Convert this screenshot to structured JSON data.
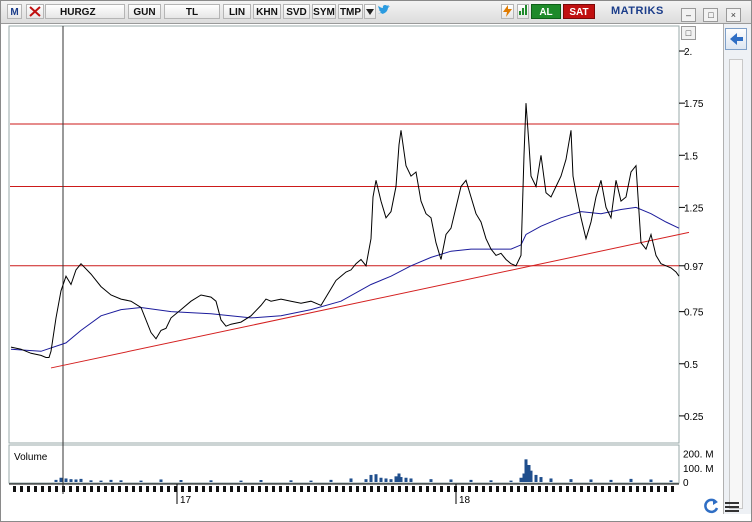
{
  "toolbar": {
    "logo": "M",
    "symbol": "HURGZ",
    "period": "GUN",
    "currency": "TL",
    "scale_lin": "LIN",
    "btn_khn": "KHN",
    "btn_svd": "SVD",
    "btn_sym": "SYM",
    "btn_tmp": "TMP",
    "buy": "AL",
    "sell": "SAT",
    "brand": "MATRIKS"
  },
  "colors": {
    "price": "#000000",
    "moving_average": "#1c1c9c",
    "support_lines": "#cc1a1a",
    "volume": "#1f4e8c",
    "buy": "#1e8a2a",
    "sell": "#c01010"
  },
  "icons": [
    "close-x-icon",
    "twitter-bird-icon",
    "lightning-icon",
    "refresh-icon",
    "menu-icon",
    "arrow-left-icon"
  ],
  "chart_data": {
    "type": "line",
    "title": "",
    "xlabel": "",
    "ylabel": "",
    "ylim": [
      0.12,
      2.12
    ],
    "y_ticks": [
      "2.",
      "1.75",
      "1.5",
      "1.25",
      "0.97",
      "0.75",
      "0.5",
      "0.25"
    ],
    "y_tick_values": [
      2.0,
      1.75,
      1.5,
      1.25,
      0.97,
      0.75,
      0.5,
      0.25
    ],
    "x_tick_labels": [
      "17",
      "18"
    ],
    "grid": false,
    "scale": "linear",
    "series": [],
    "price": {
      "x": [
        0,
        10,
        20,
        30,
        35,
        38,
        40,
        45,
        50,
        55,
        60,
        65,
        70,
        80,
        90,
        100,
        110,
        120,
        130,
        140,
        145,
        150,
        155,
        160,
        170,
        180,
        190,
        200,
        205,
        210,
        215,
        220,
        230,
        240,
        250,
        255,
        260,
        270,
        280,
        290,
        300,
        310,
        320,
        325,
        330,
        335,
        340,
        345,
        350,
        355,
        360,
        362,
        365,
        368,
        370,
        375,
        380,
        385,
        388,
        390,
        395,
        400,
        405,
        410,
        415,
        420,
        425,
        430,
        435,
        440,
        445,
        450,
        455,
        460,
        465,
        470,
        475,
        480,
        485,
        490,
        495,
        500,
        505,
        510,
        513,
        515,
        518,
        520,
        525,
        530,
        535,
        540,
        545,
        550,
        555,
        560,
        562,
        565,
        570,
        575,
        580,
        585,
        590,
        595,
        600,
        605,
        610,
        615,
        620,
        625,
        630,
        635,
        640,
        645,
        650,
        655,
        660,
        665,
        668
      ],
      "y": [
        0.58,
        0.57,
        0.55,
        0.54,
        0.53,
        0.53,
        0.56,
        0.72,
        0.85,
        0.92,
        0.88,
        0.95,
        0.98,
        0.93,
        0.87,
        0.83,
        0.81,
        0.8,
        0.77,
        0.65,
        0.62,
        0.66,
        0.67,
        0.72,
        0.76,
        0.8,
        0.83,
        0.82,
        0.8,
        0.71,
        0.68,
        0.69,
        0.7,
        0.73,
        0.78,
        0.81,
        0.8,
        0.81,
        0.8,
        0.79,
        0.8,
        0.78,
        0.86,
        0.9,
        0.92,
        0.94,
        0.95,
        0.98,
        1.0,
        0.97,
        1.1,
        1.3,
        1.38,
        1.32,
        1.28,
        1.2,
        1.23,
        1.35,
        1.55,
        1.62,
        1.45,
        1.4,
        1.42,
        1.28,
        1.22,
        1.2,
        1.08,
        1.0,
        1.12,
        1.15,
        1.25,
        1.35,
        1.38,
        1.3,
        1.22,
        1.18,
        1.1,
        1.05,
        1.02,
        1.03,
        1.0,
        0.98,
        0.97,
        1.02,
        1.5,
        1.75,
        1.55,
        1.4,
        1.35,
        1.5,
        1.32,
        1.3,
        1.35,
        1.4,
        1.48,
        1.62,
        1.4,
        1.32,
        1.2,
        1.1,
        1.18,
        1.3,
        1.38,
        1.25,
        1.2,
        1.38,
        1.28,
        1.3,
        1.42,
        1.45,
        1.08,
        1.05,
        1.12,
        1.02,
        0.98,
        0.97,
        0.96,
        0.94,
        0.92
      ]
    },
    "moving_average": {
      "x": [
        0,
        30,
        55,
        70,
        90,
        110,
        130,
        160,
        200,
        240,
        270,
        300,
        330,
        360,
        380,
        400,
        420,
        440,
        460,
        480,
        500,
        510,
        515,
        530,
        550,
        570,
        590,
        610,
        625,
        640,
        655,
        668
      ],
      "y": [
        0.57,
        0.56,
        0.6,
        0.66,
        0.73,
        0.76,
        0.77,
        0.75,
        0.74,
        0.72,
        0.73,
        0.76,
        0.8,
        0.88,
        0.92,
        0.97,
        1.01,
        1.04,
        1.05,
        1.05,
        1.05,
        1.07,
        1.12,
        1.16,
        1.2,
        1.23,
        1.22,
        1.24,
        1.25,
        1.22,
        1.18,
        1.15
      ]
    },
    "horizontal_lines": [
      1.65,
      1.35,
      0.97
    ],
    "trendline": {
      "x": [
        40,
        678
      ],
      "y": [
        0.48,
        1.13
      ]
    },
    "x_tick_positions": [
      176,
      455
    ],
    "volume": {
      "label": "Volume",
      "y_ticks": [
        "200. M",
        "100. M",
        "0"
      ],
      "y_tick_values": [
        200,
        100,
        0
      ],
      "unit": "M",
      "x": [
        45,
        50,
        55,
        60,
        65,
        70,
        80,
        90,
        100,
        110,
        130,
        150,
        170,
        200,
        230,
        250,
        280,
        300,
        320,
        340,
        355,
        360,
        365,
        370,
        375,
        380,
        385,
        388,
        390,
        395,
        400,
        420,
        440,
        460,
        480,
        500,
        510,
        513,
        515,
        518,
        520,
        525,
        530,
        540,
        560,
        580,
        600,
        620,
        640,
        660
      ],
      "values": [
        15,
        30,
        25,
        20,
        18,
        22,
        12,
        10,
        15,
        12,
        10,
        18,
        14,
        12,
        10,
        14,
        12,
        10,
        15,
        25,
        20,
        50,
        55,
        30,
        25,
        20,
        40,
        60,
        35,
        30,
        25,
        20,
        18,
        15,
        12,
        10,
        30,
        60,
        160,
        120,
        80,
        50,
        35,
        25,
        20,
        18,
        15,
        22,
        18,
        12
      ]
    }
  }
}
